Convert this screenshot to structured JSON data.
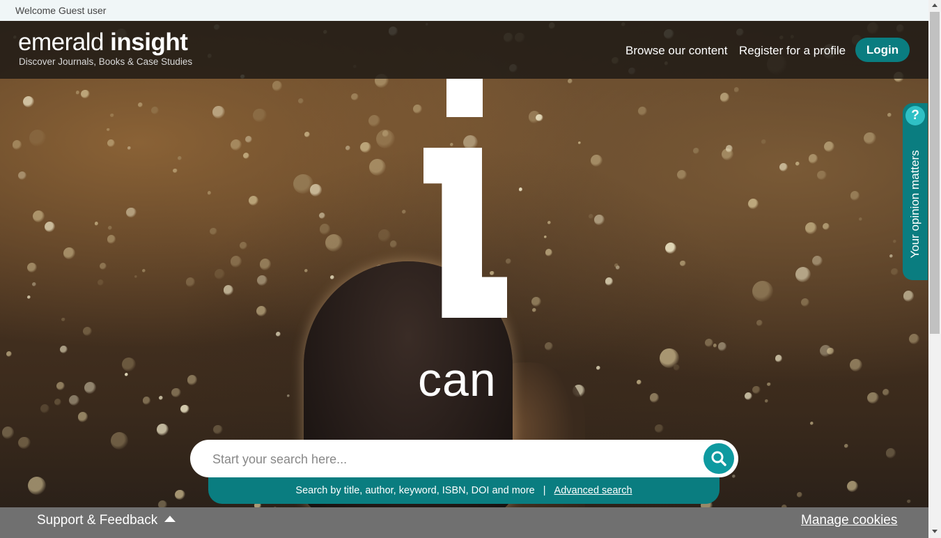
{
  "welcome": {
    "text": "Welcome Guest user"
  },
  "header": {
    "logo_light": "emerald ",
    "logo_bold": "insight",
    "tagline": "Discover Journals, Books & Case Studies",
    "nav": {
      "browse_label": "Browse our content",
      "register_label": "Register for a profile",
      "login_label": "Login"
    }
  },
  "hero": {
    "word": "can"
  },
  "search": {
    "placeholder": "Start your search here...",
    "hint": "Search by title, author, keyword, ISBN, DOI and more",
    "separator": "|",
    "advanced_label": "Advanced search"
  },
  "feedback": {
    "icon_glyph": "?",
    "label": "Your opinion matters"
  },
  "footer": {
    "support_label": "Support & Feedback",
    "cookies_label": "Manage cookies"
  },
  "colors": {
    "accent": "#0a7d80",
    "search_button": "#0e9aa0",
    "footer": "#707070"
  },
  "icons": {
    "search": "search-icon",
    "caret": "caret-up-icon",
    "question": "question-icon",
    "scroll_up": "scroll-up-arrow-icon",
    "scroll_down": "scroll-down-arrow-icon"
  }
}
